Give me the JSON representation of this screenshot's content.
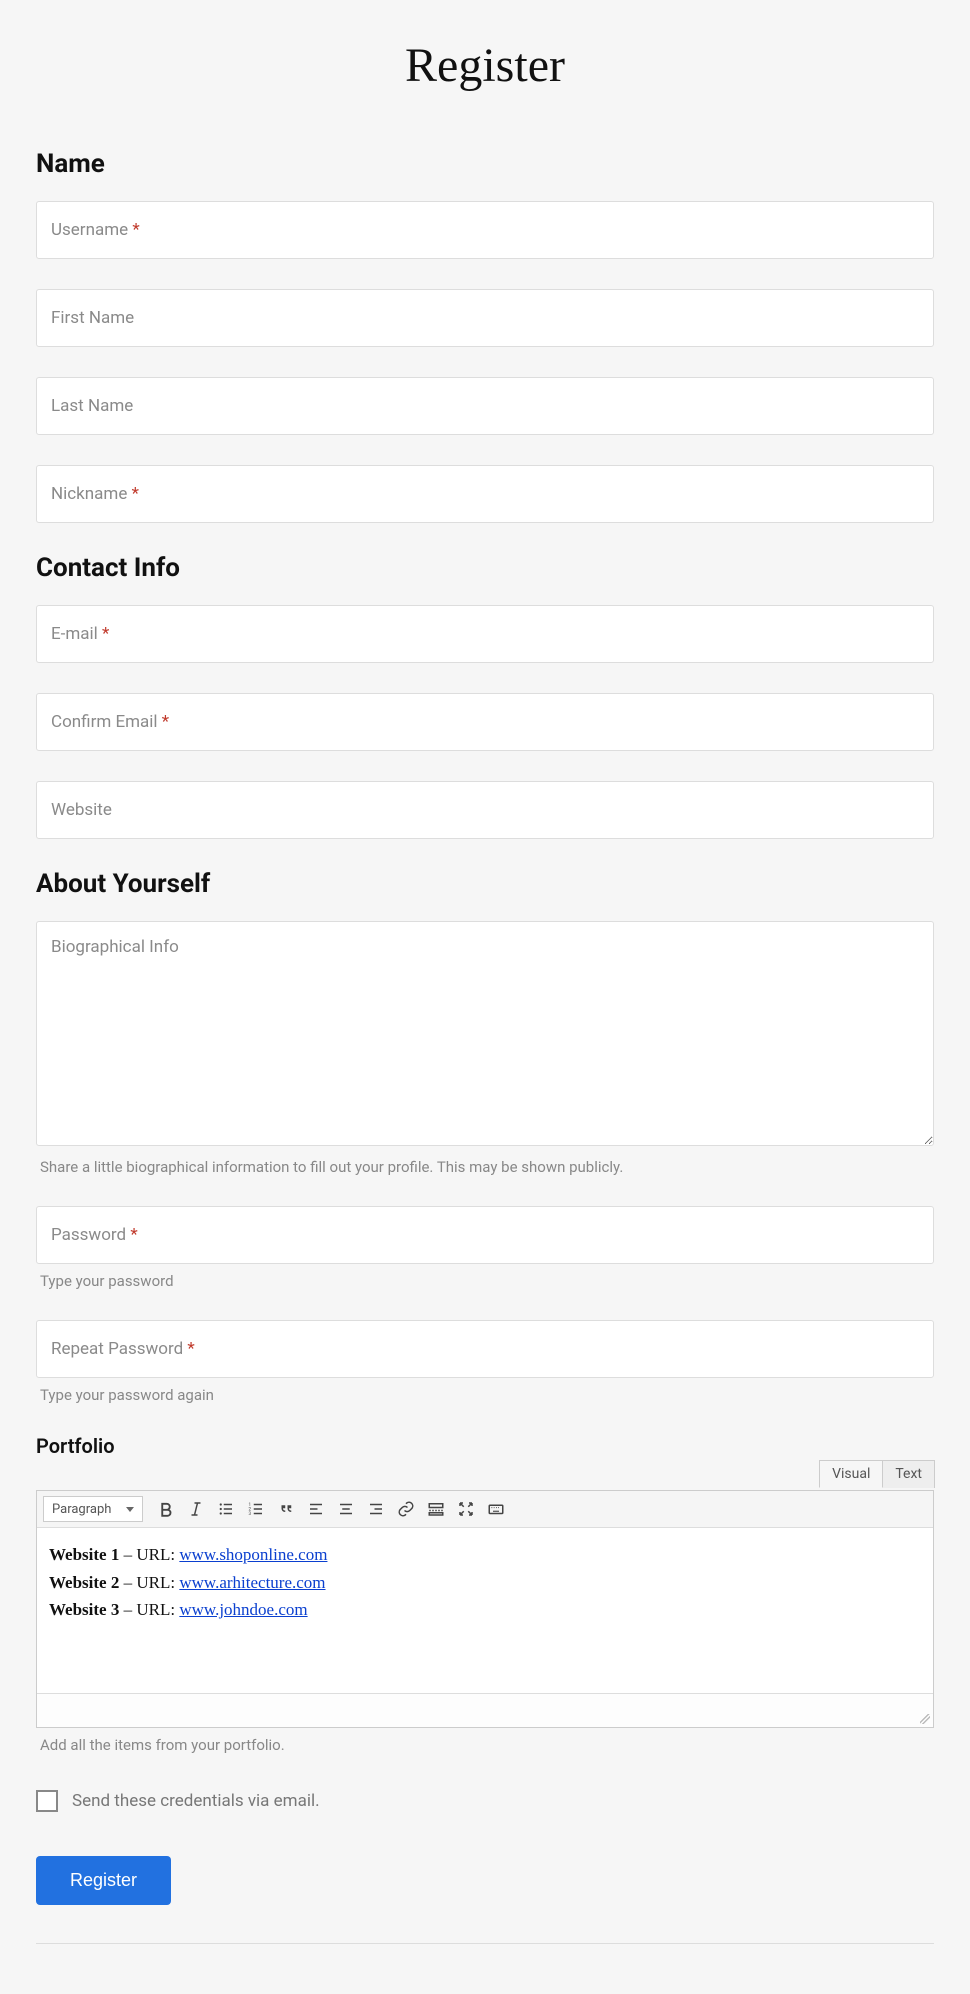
{
  "title": "Register",
  "sections": {
    "name": "Name",
    "contact": "Contact Info",
    "about": "About Yourself"
  },
  "fields": {
    "username": {
      "label": "Username",
      "required": true
    },
    "first_name": {
      "label": "First Name",
      "required": false
    },
    "last_name": {
      "label": "Last Name",
      "required": false
    },
    "nickname": {
      "label": "Nickname",
      "required": true
    },
    "email": {
      "label": "E-mail",
      "required": true
    },
    "confirm_email": {
      "label": "Confirm Email",
      "required": true
    },
    "website": {
      "label": "Website",
      "required": false
    },
    "bio": {
      "label": "Biographical Info",
      "hint": "Share a little biographical information to fill out your profile. This may be shown publicly."
    },
    "password": {
      "label": "Password",
      "required": true,
      "hint": "Type your password"
    },
    "repeat_password": {
      "label": "Repeat Password",
      "required": true,
      "hint": "Type your password again"
    }
  },
  "portfolio": {
    "heading": "Portfolio",
    "hint": "Add all the items from your portfolio.",
    "tabs": {
      "visual": "Visual",
      "text": "Text"
    },
    "format_select": "Paragraph",
    "entries": [
      {
        "label": "Website 1",
        "sep": " – URL: ",
        "link_text": "www.shoponline.com"
      },
      {
        "label": "Website 2",
        "sep": " – URL: ",
        "link_text": "www.arhitecture.com"
      },
      {
        "label": "Website 3",
        "sep": " – URL: ",
        "link_text": "www.johndoe.com"
      }
    ]
  },
  "send_credentials_label": "Send these credentials via email.",
  "submit_label": "Register",
  "required_marker": "*"
}
